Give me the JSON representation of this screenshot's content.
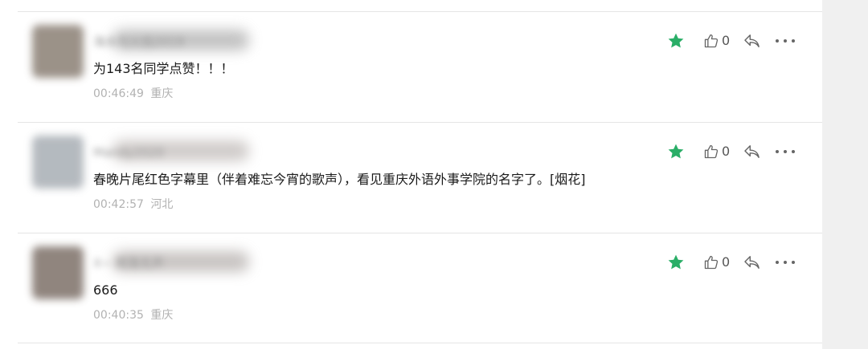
{
  "comments": [
    {
      "nickname": "海水与火焰2019",
      "text": "为143名同学点赞！！！",
      "time": "00:46:49",
      "location": "重庆",
      "like_count": "0",
      "avatar_color": "#8a7f74"
    },
    {
      "nickname": "Mandy2020",
      "text": "春晚片尾红色字幕里（伴着难忘今宵的歌声），看见重庆外语外事学院的名字了。[烟花]",
      "time": "00:42:57",
      "location": "河北",
      "like_count": "0",
      "avatar_color": "#a8aeb4"
    },
    {
      "nickname": "X~ 雨落无声",
      "text": "666",
      "time": "00:40:35",
      "location": "重庆",
      "like_count": "0",
      "avatar_color": "#7d7068"
    }
  ],
  "colors": {
    "star": "#2aae67",
    "icon": "#666666",
    "divider": "#e5e5e5",
    "meta": "#b2b2b2",
    "text": "#1a1a1a"
  },
  "icons": {
    "star": "star-icon",
    "like": "thumbs-up-icon",
    "reply": "reply-icon",
    "more": "more-icon"
  }
}
